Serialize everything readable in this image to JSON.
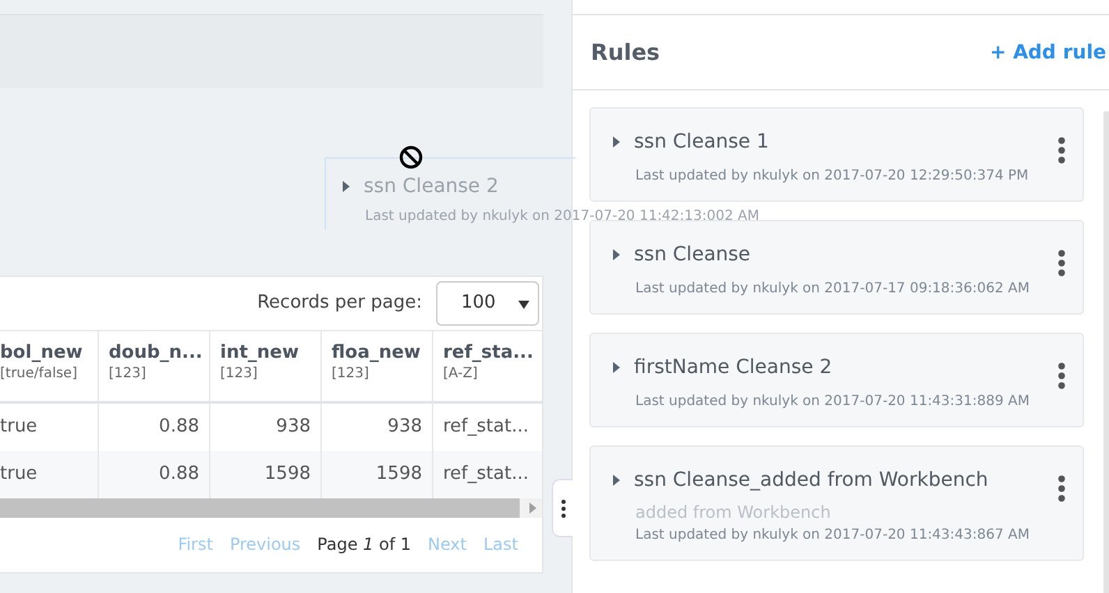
{
  "table": {
    "records_per_page_label": "Records per page:",
    "records_per_page": "100",
    "columns": [
      {
        "name": "bol_new",
        "type": "[true/false]",
        "kind": "text"
      },
      {
        "name": "doub_n...",
        "type": "[123]",
        "kind": "number"
      },
      {
        "name": "int_new",
        "type": "[123]",
        "kind": "number"
      },
      {
        "name": "floa_new",
        "type": "[123]",
        "kind": "number"
      },
      {
        "name": "ref_sta...",
        "type": "[A-Z]",
        "kind": "text"
      }
    ],
    "rows": [
      [
        "true",
        "0.88",
        "938",
        "938",
        "ref_stat..."
      ],
      [
        "true",
        "0.88",
        "1598",
        "1598",
        "ref_stat..."
      ]
    ],
    "pagination": {
      "first": "First",
      "previous": "Previous",
      "page_prefix": "Page ",
      "page_current": "1",
      "page_suffix": " of 1",
      "next": "Next",
      "last": "Last"
    }
  },
  "drag_ghost": {
    "title": "ssn Cleanse 2",
    "meta": "Last updated by nkulyk on 2017-07-20 11:42:13:002 AM"
  },
  "rules_panel": {
    "title": "Rules",
    "add_button": "+ Add rule",
    "rules": [
      {
        "name": "ssn Cleanse 1",
        "meta": "Last updated by nkulyk on 2017-07-20 12:29:50:374 PM"
      },
      {
        "name": "ssn Cleanse",
        "meta": "Last updated by nkulyk on 2017-07-17 09:18:36:062 AM"
      },
      {
        "name": "firstName Cleanse 2",
        "meta": "Last updated by nkulyk on 2017-07-20 11:43:31:889 AM"
      },
      {
        "name": "ssn Cleanse_added from Workbench",
        "description": "added from Workbench",
        "meta": "Last updated by nkulyk on 2017-07-20 11:43:43:867 AM"
      }
    ]
  }
}
